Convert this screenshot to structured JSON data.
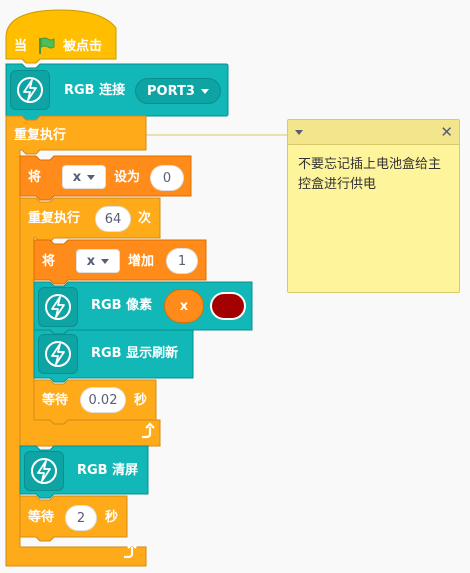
{
  "blocks": {
    "when_flag": {
      "prefix": "当",
      "suffix": "被点击"
    },
    "rgb_connect": {
      "label": "RGB 连接",
      "port": "PORT3"
    },
    "forever": {
      "label": "重复执行"
    },
    "set_var": {
      "label": "将",
      "var": "x",
      "to": "设为",
      "value": "0"
    },
    "repeat": {
      "label": "重复执行",
      "count": "64",
      "unit": "次"
    },
    "change_var": {
      "label": "将",
      "var": "x",
      "by": "增加",
      "value": "1"
    },
    "rgb_pixel": {
      "label": "RGB 像素",
      "index": "x",
      "color": "#a30000"
    },
    "rgb_show": {
      "label": "RGB 显示刷新"
    },
    "wait_inner": {
      "label": "等待",
      "value": "0.02",
      "unit": "秒"
    },
    "rgb_clear": {
      "label": "RGB 清屏"
    },
    "wait_outer": {
      "label": "等待",
      "value": "2",
      "unit": "秒"
    }
  },
  "comment": {
    "text": "不要忘记插上电池盒给主控盒进行供电"
  },
  "colors": {
    "event": "#ffbf00",
    "control": "#ffab19",
    "variable": "#ff8c1a",
    "extension": "#12b8b8",
    "flag": "#4cbf56",
    "note": "#fef49c"
  },
  "icons": [
    "green-flag-icon",
    "lightning-icon",
    "dropdown-arrow-icon",
    "loop-arrow-icon",
    "collapse-arrow-icon",
    "close-icon"
  ]
}
